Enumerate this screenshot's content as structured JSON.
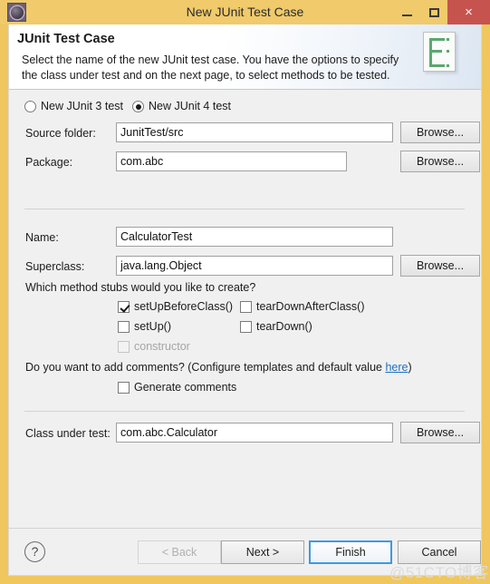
{
  "window": {
    "title": "New JUnit Test Case",
    "icon": "gear-icon",
    "minimize_label": "–",
    "maximize_label": "□",
    "close_label": "×",
    "border_color": "#efc75e",
    "titlebar_color": "#f0ca6b",
    "close_button_color": "#c7534f"
  },
  "banner": {
    "title": "JUnit Test Case",
    "description": "Select the name of the new JUnit test case. You have the options to specify the class under test and on the next page, to select methods to be tested.",
    "icon": "junit-document-icon",
    "icon_accent_color": "#5aa86f"
  },
  "junit_version": {
    "options": [
      {
        "label": "New JUnit 3 test",
        "selected": false
      },
      {
        "label": "New JUnit 4 test",
        "selected": true
      }
    ]
  },
  "fields": {
    "source_folder": {
      "label": "Source folder:",
      "value": "JunitTest/src",
      "placeholder": "",
      "browse_label": "Browse..."
    },
    "package": {
      "label": "Package:",
      "value": "com.abc",
      "placeholder": "",
      "browse_label": "Browse..."
    },
    "name": {
      "label": "Name:",
      "value": "CalculatorTest",
      "placeholder": ""
    },
    "superclass": {
      "label": "Superclass:",
      "value": "java.lang.Object",
      "placeholder": "",
      "browse_label": "Browse..."
    },
    "class_under_test": {
      "label": "Class under test:",
      "value": "com.abc.Calculator",
      "placeholder": "",
      "browse_label": "Browse..."
    }
  },
  "method_stubs": {
    "prompt": "Which method stubs would you like to create?",
    "items": [
      {
        "label": "setUpBeforeClass()",
        "checked": true,
        "disabled": false
      },
      {
        "label": "tearDownAfterClass()",
        "checked": false,
        "disabled": false
      },
      {
        "label": "setUp()",
        "checked": false,
        "disabled": false
      },
      {
        "label": "tearDown()",
        "checked": false,
        "disabled": false
      },
      {
        "label": "constructor",
        "checked": false,
        "disabled": true
      }
    ]
  },
  "comments": {
    "prompt_before_link": "Do you want to add comments? (Configure templates and default value ",
    "link_label": "here",
    "prompt_after_link": ")",
    "link_color": "#1f6fc4",
    "checkbox": {
      "label": "Generate comments",
      "checked": false
    }
  },
  "buttons": {
    "help_label": "?",
    "back": {
      "label": "< Back",
      "disabled": true,
      "focused": false
    },
    "next": {
      "label": "Next >",
      "disabled": false,
      "focused": false
    },
    "finish": {
      "label": "Finish",
      "disabled": false,
      "focused": true
    },
    "cancel": {
      "label": "Cancel",
      "disabled": false,
      "focused": false
    }
  },
  "watermark": {
    "text": "@51CTO博客"
  }
}
